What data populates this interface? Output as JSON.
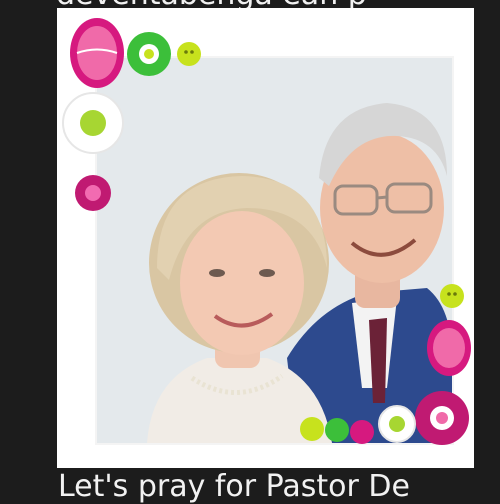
{
  "post": {
    "top_caption": "deventabenga ean p",
    "bottom_caption": "Let's pray for Pastor De"
  },
  "image": {
    "icon": "couple-portrait-photo",
    "frame_style": "scrapbook-flowers-buttons"
  },
  "colors": {
    "page_background": "#1c1c1c",
    "caption_text": "#f2f2f2",
    "frame_white": "#ffffff",
    "magenta": "#d6197f",
    "green": "#3cbf3a",
    "lime": "#c7e21d",
    "suit_blue": "#2d4a8e"
  }
}
